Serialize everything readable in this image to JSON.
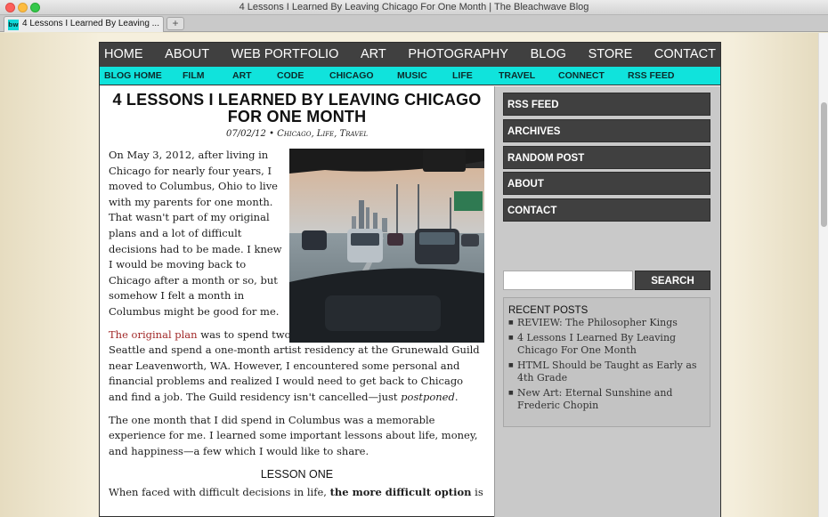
{
  "window": {
    "title": "4 Lessons I Learned By Leaving Chicago For One Month | The Bleachwave Blog",
    "tab_label": "4 Lessons I Learned By Leaving ...",
    "favicon_text": "bw"
  },
  "nav": {
    "main": [
      "HOME",
      "ABOUT",
      "WEB PORTFOLIO",
      "ART",
      "PHOTOGRAPHY",
      "BLOG",
      "STORE",
      "CONTACT"
    ],
    "sub": [
      "BLOG HOME",
      "FILM",
      "ART",
      "CODE",
      "CHICAGO",
      "MUSIC",
      "LIFE",
      "TRAVEL",
      "CONNECT",
      "RSS FEED"
    ]
  },
  "post": {
    "title": "4 LESSONS I LEARNED BY LEAVING CHICAGO FOR ONE MONTH",
    "date": "07/02/12",
    "categories": [
      "Chicago",
      "Life",
      "Travel"
    ],
    "para1": "On May 3, 2012, after living in Chicago for nearly four years, I moved to Columbus, Ohio to live with my parents for one month. That wasn't part of my original plans and a lot of difficult decisions had to be made. I knew I would be moving back to Chicago after a month or so, but somehow I felt a month in Columbus might be good for me.",
    "para2_link": "The original plan",
    "para2_rest": " was to spend two months in Columbus, then fly out to Seattle and spend a one-month artist residency at the Grunewald Guild near Leavenworth, WA. However, I encountered some personal and financial problems and realized I would need to get back to Chicago and find a job. The Guild residency isn't cancelled—just ",
    "para2_em": "postponed",
    "para3": "The one month that I did spend in Columbus was a memorable experience for me. I learned some important lessons about life, money, and happiness—a few which I would like to share.",
    "lesson_heading": "LESSON ONE",
    "para4_start": "When faced with difficult decisions in life, ",
    "para4_bold": "the more difficult option",
    "para4_end": " is"
  },
  "sidebar": {
    "buttons": [
      "RSS FEED",
      "ARCHIVES",
      "RANDOM POST",
      "ABOUT",
      "CONTACT"
    ],
    "search_button": "SEARCH",
    "search_value": "",
    "recent_title": "RECENT POSTS",
    "recent_posts": [
      "REVIEW: The Philosopher Kings",
      "4 Lessons I Learned By Leaving Chicago For One Month",
      "HTML Should be Taught as Early as 4th Grade",
      "New Art: Eternal Sunshine and Frederic Chopin"
    ]
  },
  "colors": {
    "nav_bg": "#404040",
    "subnav_bg": "#10e3dc",
    "link": "#a22a2a",
    "sidebar_bg": "#c9c9c9"
  }
}
